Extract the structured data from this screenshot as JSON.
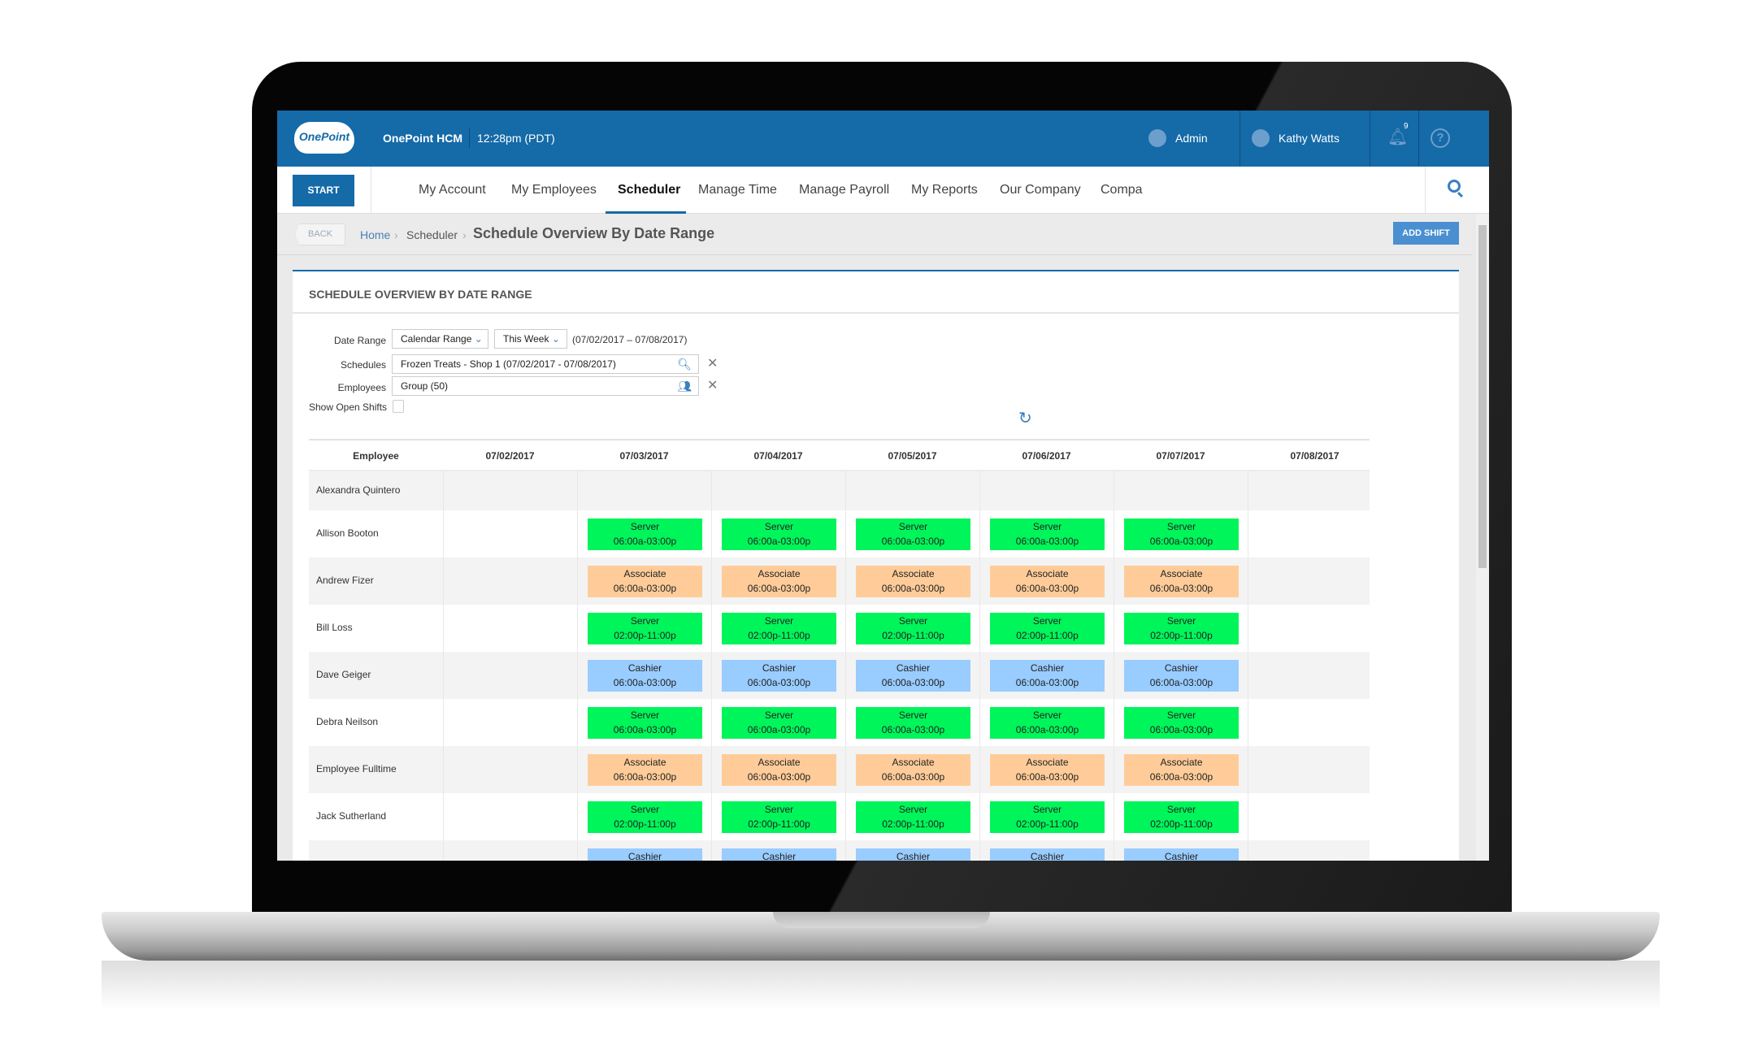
{
  "header": {
    "logo_text": "OnePoint",
    "app_name": "OnePoint HCM",
    "time": "12:28pm (PDT)",
    "role": "Admin",
    "user": "Kathy Watts",
    "notification_count": "9",
    "brand_color": "#156aa8"
  },
  "nav": {
    "start": "START",
    "items": [
      "My Account",
      "My Employees",
      "Scheduler",
      "Manage Time",
      "Manage Payroll",
      "My Reports",
      "Our Company",
      "Compa"
    ],
    "active": "Scheduler"
  },
  "breadcrumb": {
    "back": "BACK",
    "home": "Home",
    "section": "Scheduler",
    "title": "Schedule Overview By Date Range",
    "sep": "›"
  },
  "actions": {
    "add_shift": "ADD SHIFT"
  },
  "panel": {
    "title": "SCHEDULE OVERVIEW BY DATE RANGE"
  },
  "filters": {
    "date_range_label": "Date Range",
    "range_type": "Calendar Range",
    "range_period": "This Week",
    "range_text": "(07/02/2017 – 07/08/2017)",
    "schedules_label": "Schedules",
    "schedules_value": "Frozen Treats - Shop 1 (07/02/2017 - 07/08/2017)",
    "employees_label": "Employees",
    "employees_value": "Group (50)",
    "open_shifts_label": "Show Open Shifts",
    "open_shifts_checked": false,
    "clear": "✕"
  },
  "table": {
    "headers": [
      "Employee",
      "07/02/2017",
      "07/03/2017",
      "07/04/2017",
      "07/05/2017",
      "07/06/2017",
      "07/07/2017",
      "07/08/2017"
    ],
    "role_colors": {
      "Server": "#00f55a",
      "Associate": "#ffcc99",
      "Cashier": "#99ccff"
    },
    "rows": [
      {
        "name": "Alexandra Quintero",
        "role": null,
        "time": null
      },
      {
        "name": "Allison Booton",
        "role": "Server",
        "time": "06:00a-03:00p"
      },
      {
        "name": "Andrew Fizer",
        "role": "Associate",
        "time": "06:00a-03:00p"
      },
      {
        "name": "Bill Loss",
        "role": "Server",
        "time": "02:00p-11:00p"
      },
      {
        "name": "Dave Geiger",
        "role": "Cashier",
        "time": "06:00a-03:00p"
      },
      {
        "name": "Debra Neilson",
        "role": "Server",
        "time": "06:00a-03:00p"
      },
      {
        "name": "Employee Fulltime",
        "role": "Associate",
        "time": "06:00a-03:00p"
      },
      {
        "name": "Jack Sutherland",
        "role": "Server",
        "time": "02:00p-11:00p"
      },
      {
        "name": "",
        "role": "Cashier",
        "time": ""
      }
    ]
  }
}
